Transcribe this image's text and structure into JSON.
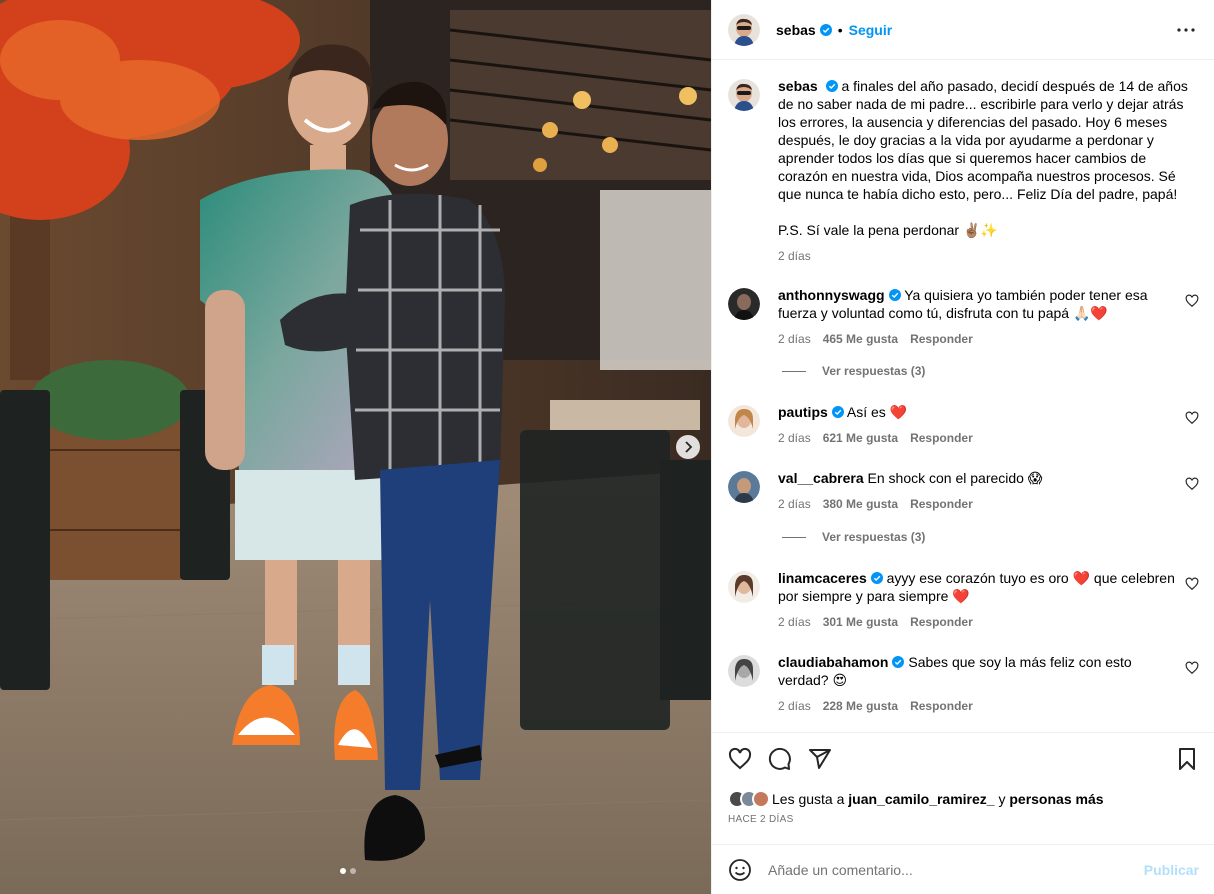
{
  "post": {
    "author": "sebas",
    "follow_label": "Seguir",
    "separator": "•",
    "caption": "a finales del año pasado, decidí después de 14 de años de no saber nada de mi padre... escribirle para verlo y dejar atrás los errores, la ausencia y diferencias del pasado. Hoy 6 meses después, le doy gracias a la vida por ayudarme a perdonar y aprender todos los días que si queremos hacer cambios de corazón en nuestra vida, Dios acompaña nuestros procesos. Sé que nunca te había dicho esto, pero... Feliz Día del padre, papá!",
    "caption_ps": "P.S. Sí vale la pena perdonar ✌🏽✨",
    "caption_age": "2 días",
    "time_ago": "HACE 2 DÍAS"
  },
  "comments": [
    {
      "user": "anthonnyswagg",
      "text": "Ya quisiera yo también poder tener esa fuerza y voluntad como tú, disfruta con tu papá 🙏🏻❤️",
      "age": "2 días",
      "likes": "465 Me gusta",
      "reply": "Responder",
      "replies": "Ver respuestas (3)"
    },
    {
      "user": "pautips",
      "text": "Así es ❤️",
      "age": "2 días",
      "likes": "621 Me gusta",
      "reply": "Responder"
    },
    {
      "user": "val__cabrera",
      "text": "En shock con el parecido 😱",
      "age": "2 días",
      "likes": "380 Me gusta",
      "reply": "Responder",
      "replies": "Ver respuestas (3)"
    },
    {
      "user": "linamcaceres",
      "text": "ayyy ese corazón tuyo es oro ❤️ que celebren por siempre y para siempre ❤️",
      "age": "2 días",
      "likes": "301 Me gusta",
      "reply": "Responder"
    },
    {
      "user": "claudiabahamon",
      "text": "Sabes que soy la más feliz con esto verdad? 😍",
      "age": "2 días",
      "likes": "228 Me gusta",
      "reply": "Responder"
    }
  ],
  "likes_line": {
    "prefix": "Les gusta a",
    "user": "juan_camilo_ramirez_",
    "middle": "y",
    "rest": "personas más"
  },
  "composer": {
    "placeholder": "Añade un comentario...",
    "publish_label": "Publicar"
  },
  "carousel": {
    "current": 1,
    "total": 2
  },
  "colors": {
    "accent": "#0095f6",
    "verified": "#0095f6",
    "publish_disabled": "#b2dffc",
    "muted": "#737373"
  }
}
